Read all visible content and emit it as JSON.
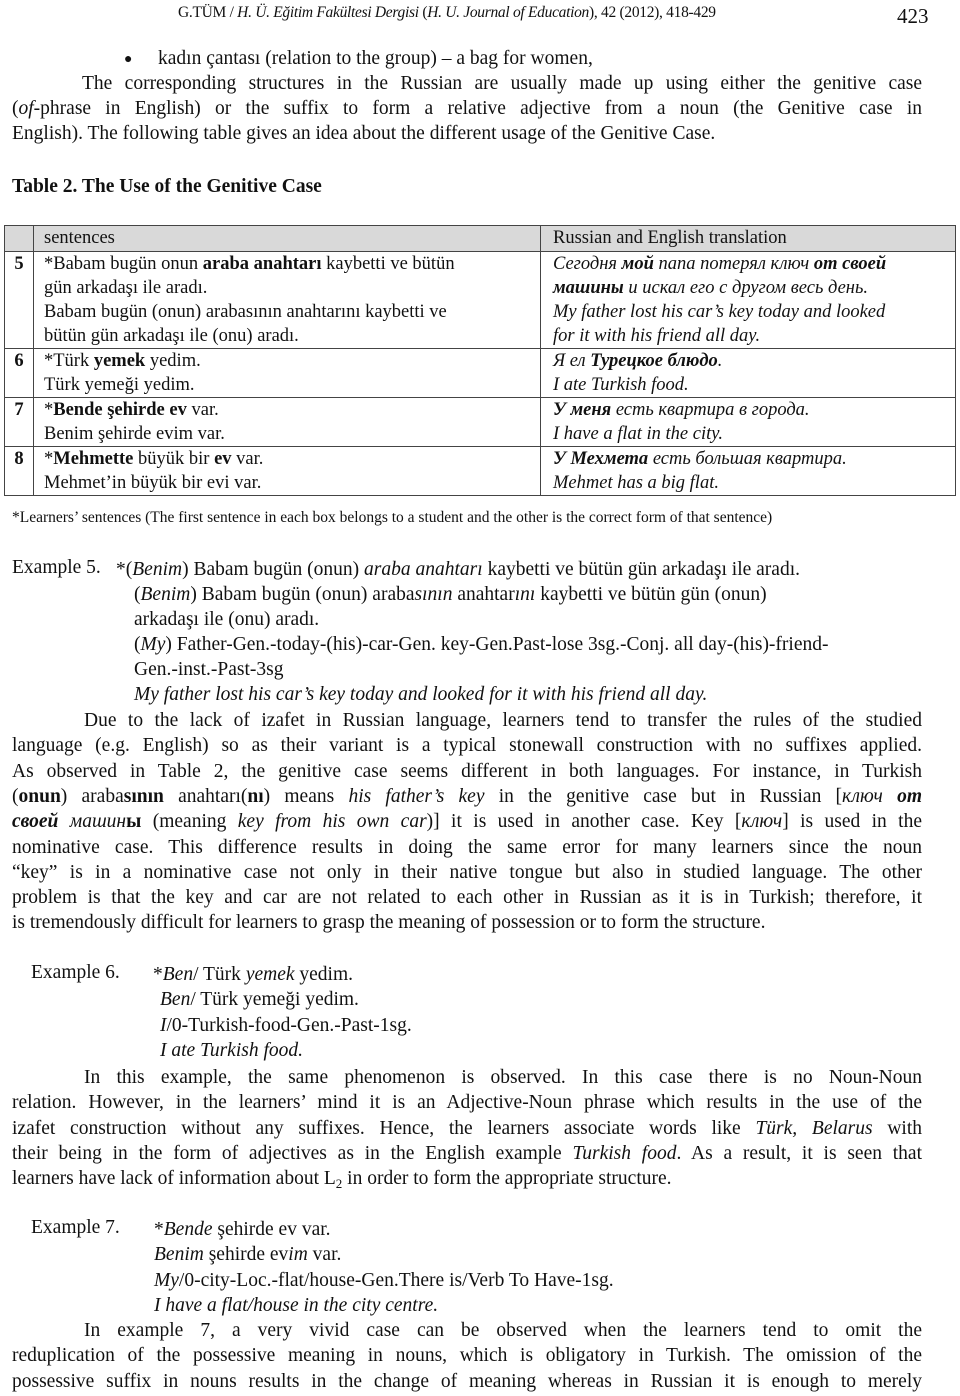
{
  "running_head": {
    "text": [
      {
        "t": "G.TÜM / "
      },
      {
        "t": "H. Ü. Eğitim Fakültesi Dergisi",
        "s": "i"
      },
      {
        "t": " ("
      },
      {
        "t": "H. U. Journal of Education",
        "s": "i"
      },
      {
        "t": "), 42 (2012), 418-429"
      }
    ],
    "page_number": "423"
  },
  "intro": {
    "bullet_item": [
      {
        "t": "kadın çantası (relation to the group) – a bag for women,"
      }
    ],
    "paragraph_lines": [
      [
        {
          "t": "The corresponding structures in the Russian are usually made up using either the genitive case"
        }
      ],
      [
        {
          "t": "("
        },
        {
          "t": "of",
          "s": "i"
        },
        {
          "t": "-phrase in English) or the suffix to form a relative adjective from a noun (the Genitive case in"
        }
      ],
      [
        {
          "t": "English). The following table gives an idea about the different usage of the Genitive Case."
        }
      ]
    ]
  },
  "table": {
    "caption": "Table 2. The Use of the Genitive Case",
    "headers": [
      "",
      "sentences",
      "Russian and English translation"
    ],
    "rows": [
      {
        "num": "5",
        "sentences": [
          [
            {
              "t": "*Babam bugün onun "
            },
            {
              "t": "araba anahtarı",
              "s": "b"
            },
            {
              "t": " kaybetti ve bütün"
            }
          ],
          [
            {
              "t": "gün arkadaşı ile aradı."
            }
          ],
          [
            {
              "t": "Babam bugün (onun) arabasının anahtarını kaybetti ve"
            }
          ],
          [
            {
              "t": "bütün gün arkadaşı ile (onu) aradı."
            }
          ]
        ],
        "translation": [
          [
            {
              "t": "Сегодня ",
              "s": "i"
            },
            {
              "t": "мой",
              "s": "bi"
            },
            {
              "t": " папа потерял ключ ",
              "s": "i"
            },
            {
              "t": "от своей",
              "s": "bi"
            }
          ],
          [
            {
              "t": "машины",
              "s": "bi"
            },
            {
              "t": " и искал его с другом весь день.",
              "s": "i"
            }
          ],
          [
            {
              "t": "My father lost his car’s key today and looked",
              "s": "i"
            }
          ],
          [
            {
              "t": "for it with his friend all day.",
              "s": "i"
            }
          ]
        ]
      },
      {
        "num": "6",
        "sentences": [
          [
            {
              "t": "*Türk "
            },
            {
              "t": "yemek",
              "s": "b"
            },
            {
              "t": "  yedim."
            }
          ],
          [
            {
              "t": " Türk yemeği  yedim."
            }
          ]
        ],
        "translation": [
          [
            {
              "t": "Я ел ",
              "s": "i"
            },
            {
              "t": "Турецкое блюдо",
              "s": "bi"
            },
            {
              "t": ".",
              "s": "i"
            }
          ],
          [
            {
              "t": "I ate Turkish food.",
              "s": "i"
            }
          ]
        ]
      },
      {
        "num": "7",
        "sentences": [
          [
            {
              "t": "*"
            },
            {
              "t": "Bende şehirde ev",
              "s": "b"
            },
            {
              "t": " var."
            }
          ],
          [
            {
              "t": " Benim şehirde evim var."
            }
          ]
        ],
        "translation": [
          [
            {
              "t": "У меня",
              "s": "bi"
            },
            {
              "t": " есть квартира в города.",
              "s": "i"
            }
          ],
          [
            {
              "t": "I have a flat in the city.",
              "s": "i"
            }
          ]
        ]
      },
      {
        "num": "8",
        "sentences": [
          [
            {
              "t": "*"
            },
            {
              "t": "Mehmette",
              "s": "b"
            },
            {
              "t": " büyük bir "
            },
            {
              "t": "ev",
              "s": "b"
            },
            {
              "t": " var."
            }
          ],
          [
            {
              "t": " Mehmet’in büyük bir evi var."
            }
          ]
        ],
        "translation": [
          [
            {
              "t": "У Мехмета",
              "s": "bi"
            },
            {
              "t": " есть большая квартира.",
              "s": "i"
            }
          ],
          [
            {
              "t": "Mehmet has a big flat.",
              "s": "i"
            }
          ]
        ]
      }
    ],
    "footnote": "*Learners’ sentences (The first sentence in each box belongs to a student and the other is the correct form of that sentence)"
  },
  "example5": {
    "label": "Example 5.",
    "lines": [
      [
        {
          "t": "*("
        },
        {
          "t": "Benim",
          "s": "i"
        },
        {
          "t": ") Babam bugün (onun) "
        },
        {
          "t": "araba anahtarı",
          "s": "i"
        },
        {
          "t": " kaybetti ve bütün gün arkadaşı ile aradı."
        }
      ],
      [
        {
          "t": "("
        },
        {
          "t": "Benim",
          "s": "i"
        },
        {
          "t": ") Babam bugün (onun) araba"
        },
        {
          "t": "sının",
          "s": "i"
        },
        {
          "t": " anahtar"
        },
        {
          "t": "ını",
          "s": "i"
        },
        {
          "t": " kaybetti ve bütün gün (onun)"
        }
      ],
      [
        {
          "t": " arkadaşı ile (onu) aradı."
        }
      ],
      [
        {
          "t": "("
        },
        {
          "t": "My",
          "s": "i"
        },
        {
          "t": ") Father-Gen.-today-(his)-car-Gen. key-Gen.Past-lose 3sg.-Conj. all day-(his)-friend-"
        }
      ],
      [
        {
          "t": "Gen.-inst.-Past-3sg"
        }
      ],
      [
        {
          "t": " My father lost his car’s key today and looked for it with his friend all day.",
          "s": "i"
        }
      ]
    ]
  },
  "paragraph1_lines": [
    [
      {
        "t": "Due to the lack of izafet in Russian language, learners tend to transfer the rules of the studied"
      }
    ],
    [
      {
        "t": "language (e.g. English) so as their variant is a typical stonewall construction with no suffixes applied."
      }
    ],
    [
      {
        "t": "As observed in Table 2, the genitive case seems different in both languages. For instance, in Turkish"
      }
    ],
    [
      {
        "t": "("
      },
      {
        "t": "onun",
        "s": "b"
      },
      {
        "t": ") araba"
      },
      {
        "t": "sının",
        "s": "b"
      },
      {
        "t": " anahtarı("
      },
      {
        "t": "nı",
        "s": "b"
      },
      {
        "t": ") means "
      },
      {
        "t": "his father’s key",
        "s": "i"
      },
      {
        "t": " in the genitive case but in Russian ["
      },
      {
        "t": "ключ ",
        "s": "i"
      },
      {
        "t": "от",
        "s": "bi"
      }
    ],
    [
      {
        "t": "своей",
        "s": "bi"
      },
      {
        "t": " машин",
        "s": "i"
      },
      {
        "t": "ы",
        "s": "b"
      },
      {
        "t": " (meaning "
      },
      {
        "t": "key from his own car",
        "s": "i"
      },
      {
        "t": ")] it is used in another case. Key ["
      },
      {
        "t": "ключ",
        "s": "i"
      },
      {
        "t": "] is used in the"
      }
    ],
    [
      {
        "t": "nominative case. This difference results in doing the same error for many learners since the noun"
      }
    ],
    [
      {
        "t": "“key” is in a nominative case not only in their native tongue but also in studied language. The other"
      }
    ],
    [
      {
        "t": "problem is that the key and car are not related to each other in Russian as it is in Turkish; therefore, it"
      }
    ],
    [
      {
        "t": "is tremendously difficult for learners to grasp the meaning of possession or to form the structure."
      }
    ]
  ],
  "example6": {
    "label": "Example 6.",
    "lines": [
      [
        {
          "t": "*"
        },
        {
          "t": "Ben",
          "s": "i"
        },
        {
          "t": "/ Türk "
        },
        {
          "t": "yemek",
          "s": "i"
        },
        {
          "t": " yedim."
        }
      ],
      [
        {
          "t": "Ben",
          "s": "i"
        },
        {
          "t": "/ Türk yemeği yedim."
        }
      ],
      [
        {
          "t": "I",
          "s": "i"
        },
        {
          "t": "/0-Turkish-food-Gen.-Past-1sg."
        }
      ],
      [
        {
          "t": "I ate Turkish food.",
          "s": "i"
        }
      ]
    ]
  },
  "paragraph2_lines": [
    [
      {
        "t": "In this example, the same phenomenon is observed. In this case there is no Noun-Noun"
      }
    ],
    [
      {
        "t": "relation. However, in the learners’ mind it is an Adjective-Noun phrase which results in the use of the"
      }
    ],
    [
      {
        "t": "izafet construction without any suffixes. Hence, the learners associate words like "
      },
      {
        "t": "Türk, Belarus",
        "s": "i"
      },
      {
        "t": " with"
      }
    ],
    [
      {
        "t": "their being in the form of adjectives as in the English example "
      },
      {
        "t": "Turkish food",
        "s": "i"
      },
      {
        "t": ".  As a result, it is seen that"
      }
    ],
    [
      {
        "t": "learners have lack of information about L"
      },
      {
        "t": "2",
        "s": "sub"
      },
      {
        "t": " in order to form the appropriate structure."
      }
    ]
  ],
  "example7": {
    "label": "Example 7.",
    "lines": [
      [
        {
          "t": "*"
        },
        {
          "t": "Bende",
          "s": "i"
        },
        {
          "t": " şehirde ev var."
        }
      ],
      [
        {
          "t": "Benim",
          "s": "i"
        },
        {
          "t": " şehirde ev"
        },
        {
          "t": "im",
          "s": "i"
        },
        {
          "t": " var."
        }
      ],
      [
        {
          "t": "My",
          "s": "i"
        },
        {
          "t": "/0-city-Loc.-flat/house-Gen.There is/Verb To Have-1sg."
        }
      ],
      [
        {
          "t": "I have a flat/house in the city centre.",
          "s": "i"
        }
      ]
    ]
  },
  "paragraph3_lines": [
    [
      {
        "t": "In example 7, a very vivid case can be observed when the learners tend to omit the"
      }
    ],
    [
      {
        "t": "reduplication of the possessive meaning in nouns, which is obligatory in Turkish. The omission of the"
      }
    ],
    [
      {
        "t": "possessive suffix in nouns results in the change of meaning whereas in Russian it is enough to merely"
      }
    ]
  ]
}
